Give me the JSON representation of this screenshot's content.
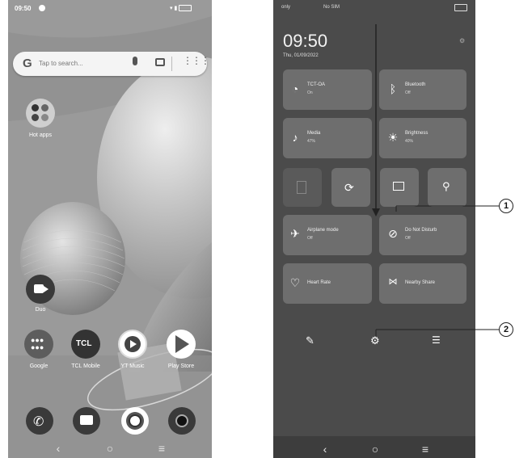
{
  "left_phone": {
    "status_time": "09:50",
    "search_placeholder": "Tap to search...",
    "google_letter": "G",
    "folder_label": "Hot apps",
    "duo_label": "Duo",
    "apps": [
      {
        "label": "Google"
      },
      {
        "label": "TCL Mobile",
        "logo": "TCL"
      },
      {
        "label": "YT Music"
      },
      {
        "label": "Play Store"
      }
    ],
    "nav": {
      "back": "‹",
      "home": "○",
      "recents": "≡"
    }
  },
  "right_phone": {
    "status_left_a": "only",
    "status_left_b": "No SIM",
    "time": "09:50",
    "date": "Thu, 01/09/2022",
    "tiles": [
      {
        "title": "TCT-OA",
        "sub": "On",
        "icon": "wifi-icon"
      },
      {
        "title": "Bluetooth",
        "sub": "Off",
        "icon": "bluetooth-icon"
      },
      {
        "title": "Media",
        "sub": "47%",
        "icon": "music-note-icon"
      },
      {
        "title": "Brightness",
        "sub": "40%",
        "icon": "sun-icon"
      },
      {
        "title": "Airplane mode",
        "sub": "Off",
        "icon": "airplane-icon"
      },
      {
        "title": "Do Not Disturb",
        "sub": "Off",
        "icon": "do-not-disturb-icon"
      },
      {
        "title": "Heart Rate",
        "sub": "",
        "icon": "heart-rate-icon"
      },
      {
        "title": "Nearby Share",
        "sub": "",
        "icon": "nearby-share-icon"
      }
    ],
    "nav": {
      "back": "‹",
      "home": "○",
      "recents": "≡"
    }
  },
  "callouts": {
    "one": "1",
    "two": "2"
  }
}
